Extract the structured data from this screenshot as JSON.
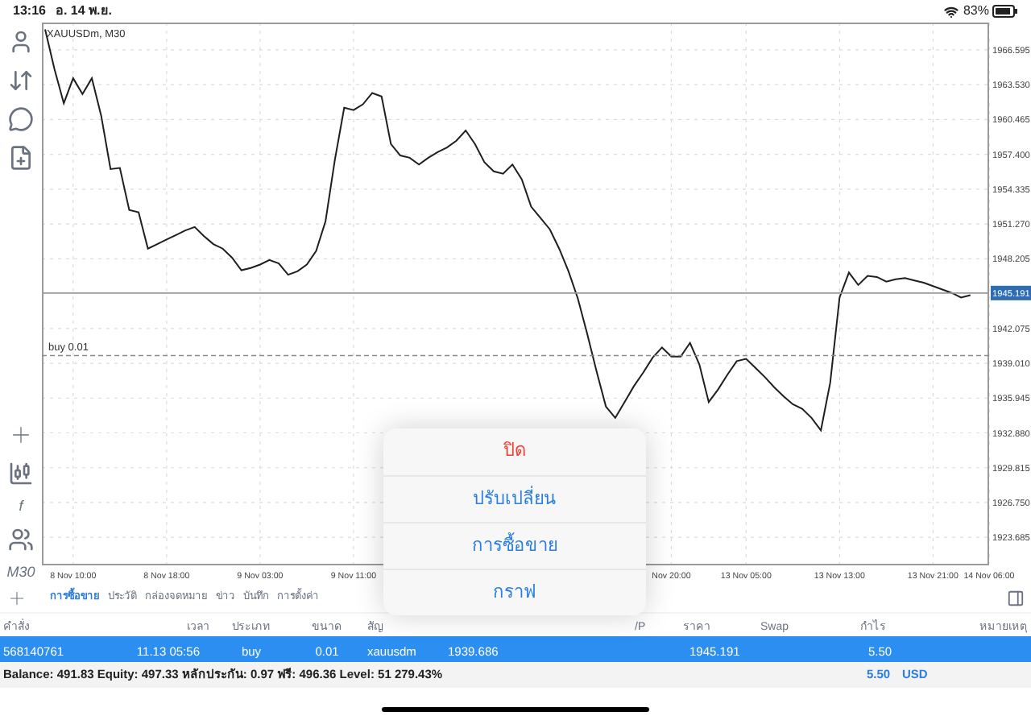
{
  "status_bar": {
    "time": "13:16",
    "date": "อ. 14 พ.ย.",
    "battery": "83%"
  },
  "toolbar": {
    "top_icons": [
      {
        "kind": "person"
      },
      {
        "kind": "transfer"
      },
      {
        "kind": "chat"
      },
      {
        "kind": "new-document"
      }
    ],
    "bottom_items": [
      {
        "kind": "crosshair"
      },
      {
        "kind": "candles"
      },
      {
        "kind": "text",
        "text": "f"
      },
      {
        "kind": "people"
      },
      {
        "kind": "text",
        "text": "M30"
      }
    ]
  },
  "chart": {
    "title": "XAUUSDm, M30",
    "chart_data": {
      "type": "line",
      "grid": true,
      "ref_lines": [
        {
          "axis": "y",
          "value": 1945.191,
          "label": "1945.191"
        },
        {
          "axis": "y",
          "value": 1939.686,
          "label": "buy 0.01"
        }
      ],
      "categories": [
        null,
        null,
        null,
        "8 Nov 10:00",
        null,
        null,
        null,
        null,
        null,
        null,
        null,
        null,
        null,
        "8 Nov 18:00",
        null,
        null,
        null,
        null,
        null,
        null,
        null,
        null,
        null,
        "9 Nov 03:00",
        null,
        null,
        null,
        null,
        null,
        null,
        null,
        null,
        null,
        "9 Nov 11:00",
        null,
        null,
        null,
        null,
        null,
        null,
        null,
        null,
        null,
        null,
        null,
        null,
        null,
        null,
        null,
        null,
        null,
        null,
        null,
        null,
        null,
        null,
        null,
        null,
        null,
        null,
        null,
        null,
        null,
        null,
        null,
        null,
        null,
        "Nov 20:00",
        null,
        null,
        null,
        null,
        null,
        null,
        null,
        "13 Nov 05:00",
        null,
        null,
        null,
        null,
        null,
        null,
        null,
        null,
        null,
        "13 Nov 13:00",
        null,
        null,
        null,
        null,
        null,
        null,
        null,
        null,
        null,
        "13 Nov 21:00",
        null,
        null,
        null,
        null,
        null,
        "14 Nov 06:00"
      ],
      "series": [
        {
          "color": "#1f1f1f",
          "values": [
            1968.4,
            1964.9,
            1961.9,
            1964.1,
            1962.7,
            1964.1,
            1960.8,
            1956.1,
            1956.2,
            1952.5,
            1952.3,
            1949.1,
            1949.5,
            1949.9,
            1950.3,
            1950.7,
            1951.0,
            1950.2,
            1949.5,
            1949.1,
            1948.3,
            1947.2,
            1947.4,
            1947.7,
            1948.1,
            1947.8,
            1946.8,
            1947.1,
            1947.7,
            1948.9,
            1951.5,
            1956.9,
            1961.5,
            1961.3,
            1961.8,
            1962.8,
            1962.5,
            1958.3,
            1957.3,
            1957.1,
            1956.5,
            1957.1,
            1957.6,
            1958.0,
            1958.6,
            1959.5,
            1958.3,
            1956.7,
            1955.9,
            1955.7,
            1956.5,
            1955.2,
            1952.8,
            1951.8,
            1950.8,
            1949.1,
            1947.1,
            1944.7,
            1941.6,
            1938.3,
            1935.2,
            1934.2,
            1935.6,
            1937.0,
            1938.2,
            1939.5,
            1940.4,
            1939.6,
            1939.6,
            1940.8,
            1938.9,
            1935.6,
            1936.7,
            1938.0,
            1939.2,
            1939.4,
            1938.6,
            1937.8,
            1936.9,
            1936.1,
            1935.4,
            1935.0,
            1934.2,
            1933.1,
            1937.3,
            1944.8,
            1947.0,
            1945.9,
            1946.7,
            1946.6,
            1946.2,
            1946.4,
            1946.5,
            1946.3,
            1946.1,
            1945.8,
            1945.5,
            1945.2,
            1944.8,
            1945.0,
            null,
            null
          ]
        }
      ],
      "ylim": [
        1921.36,
        1969.0
      ],
      "yticks": [
        {
          "value": 1966.595,
          "label": "1966.595"
        },
        {
          "value": 1963.53,
          "label": "1963.530"
        },
        {
          "value": 1960.465,
          "label": "1960.465"
        },
        {
          "value": 1957.4,
          "label": "1957.400"
        },
        {
          "value": 1954.335,
          "label": "1954.335"
        },
        {
          "value": 1951.27,
          "label": "1951.270"
        },
        {
          "value": 1948.205,
          "label": "1948.205"
        },
        {
          "value": 1942.075,
          "label": "1942.075"
        },
        {
          "value": 1939.01,
          "label": "1939.010"
        },
        {
          "value": 1935.945,
          "label": "1935.945"
        },
        {
          "value": 1932.88,
          "label": "1932.880"
        },
        {
          "value": 1929.815,
          "label": "1929.815"
        },
        {
          "value": 1926.75,
          "label": "1926.750"
        },
        {
          "value": 1923.685,
          "label": "1923.685"
        }
      ]
    }
  },
  "popup_menu": [
    {
      "label": "ปิด",
      "kind": "destructive"
    },
    {
      "label": "ปรับเปลี่ยน",
      "kind": "action"
    },
    {
      "label": "การซื้อขาย",
      "kind": "action"
    },
    {
      "label": "กราฟ",
      "kind": "action"
    }
  ],
  "tabs": [
    {
      "label": "การซื้อขาย",
      "selected": true
    },
    {
      "label": "ประวัติ",
      "selected": false
    },
    {
      "label": "กล่องจดหมาย",
      "selected": false
    },
    {
      "label": "ข่าว",
      "selected": false
    },
    {
      "label": "บันทึก",
      "selected": false
    },
    {
      "label": "การตั้งค่า",
      "selected": false
    }
  ],
  "table": {
    "columns": [
      "คำสั่ง",
      "เวลา",
      "ประเภท",
      "ขนาด",
      "สัญ",
      "/P",
      "ราคา",
      "Swap",
      "กำไร",
      "หมายเหตุ"
    ],
    "rows": [
      {
        "selected": true,
        "order": "568140761",
        "time": "11.13 05:56",
        "type": "buy",
        "volume": "0.01",
        "symbol": "xauusdm",
        "open_price": "1939.686",
        "price": "1945.191",
        "profit": "5.50"
      }
    ]
  },
  "summary": {
    "text": "Balance: 491.83 Equity: 497.33 หลักประกัน: 0.97 ฟรี: 496.36 Level: 51 279.43%",
    "profit": "5.50",
    "currency": "USD"
  }
}
